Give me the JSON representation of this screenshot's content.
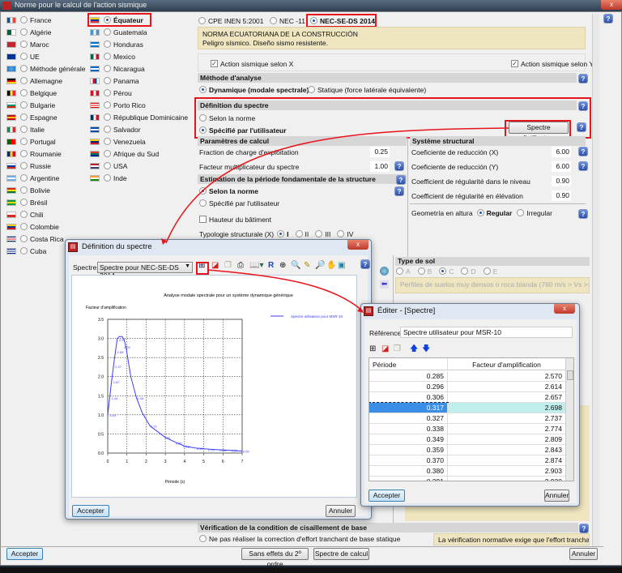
{
  "window": {
    "title": "Norme pour le calcul de l'action sismique",
    "close": "x"
  },
  "countries_col1": [
    {
      "label": "France",
      "flag": [
        "#0055a4",
        "#ffffff",
        "#ef4135"
      ],
      "dir": "v"
    },
    {
      "label": "Algérie",
      "flag": [
        "#006233",
        "#ffffff"
      ],
      "dir": "v"
    },
    {
      "label": "Maroc",
      "flag": [
        "#c1272d",
        "#c1272d"
      ],
      "dir": "v"
    },
    {
      "label": "UE",
      "flag": [
        "#003399",
        "#003399"
      ],
      "dir": "v"
    },
    {
      "label": "Méthode générale",
      "flag": [
        "#1b75c9",
        "#56a7e8"
      ],
      "dir": "globe"
    },
    {
      "label": "Allemagne",
      "flag": [
        "#000000",
        "#dd0000",
        "#ffce00"
      ],
      "dir": "h"
    },
    {
      "label": "Belgique",
      "flag": [
        "#000000",
        "#fae042",
        "#ed2939"
      ],
      "dir": "v"
    },
    {
      "label": "Bulgarie",
      "flag": [
        "#ffffff",
        "#00966e",
        "#d62612"
      ],
      "dir": "h"
    },
    {
      "label": "Espagne",
      "flag": [
        "#c60b1e",
        "#ffc400",
        "#c60b1e"
      ],
      "dir": "h"
    },
    {
      "label": "Italie",
      "flag": [
        "#009246",
        "#ffffff",
        "#ce2b37"
      ],
      "dir": "v"
    },
    {
      "label": "Portugal",
      "flag": [
        "#006600",
        "#ff0000"
      ],
      "dir": "v"
    },
    {
      "label": "Roumanie",
      "flag": [
        "#002b7f",
        "#fcd116",
        "#ce1126"
      ],
      "dir": "v"
    },
    {
      "label": "Russie",
      "flag": [
        "#ffffff",
        "#0039a6",
        "#d52b1e"
      ],
      "dir": "h"
    },
    {
      "label": "Argentine",
      "flag": [
        "#74acdf",
        "#ffffff",
        "#74acdf"
      ],
      "dir": "h"
    },
    {
      "label": "Bolivie",
      "flag": [
        "#d52b1e",
        "#f9e300",
        "#007934"
      ],
      "dir": "h"
    },
    {
      "label": "Brésil",
      "flag": [
        "#009c3b",
        "#ffdf00",
        "#009c3b"
      ],
      "dir": "h"
    },
    {
      "label": "Chili",
      "flag": [
        "#ffffff",
        "#d52b1e"
      ],
      "dir": "h"
    },
    {
      "label": "Colombie",
      "flag": [
        "#fcd116",
        "#003893",
        "#ce1126"
      ],
      "dir": "h"
    },
    {
      "label": "Costa Rica",
      "flag": [
        "#002b7f",
        "#ffffff",
        "#ce1126",
        "#ffffff",
        "#002b7f"
      ],
      "dir": "h"
    },
    {
      "label": "Cuba",
      "flag": [
        "#002a8f",
        "#ffffff",
        "#002a8f",
        "#ffffff",
        "#002a8f"
      ],
      "dir": "h"
    }
  ],
  "countries_col2": [
    {
      "label": "Équateur",
      "flag": [
        "#ffd100",
        "#0033a0",
        "#ef3340"
      ],
      "dir": "h",
      "selected": true
    },
    {
      "label": "Guatemala",
      "flag": [
        "#4997d0",
        "#ffffff",
        "#4997d0"
      ],
      "dir": "v"
    },
    {
      "label": "Honduras",
      "flag": [
        "#0073cf",
        "#ffffff",
        "#0073cf"
      ],
      "dir": "h"
    },
    {
      "label": "Mexico",
      "flag": [
        "#006847",
        "#ffffff",
        "#ce1126"
      ],
      "dir": "v"
    },
    {
      "label": "Nicaragua",
      "flag": [
        "#0067c6",
        "#ffffff",
        "#0067c6"
      ],
      "dir": "h"
    },
    {
      "label": "Panama",
      "flag": [
        "#ffffff",
        "#d21034",
        "#005293",
        "#ffffff"
      ],
      "dir": "v"
    },
    {
      "label": "Pérou",
      "flag": [
        "#d91023",
        "#ffffff",
        "#d91023"
      ],
      "dir": "v"
    },
    {
      "label": "Porto Rico",
      "flag": [
        "#ed0000",
        "#ffffff",
        "#ed0000",
        "#ffffff",
        "#ed0000"
      ],
      "dir": "h"
    },
    {
      "label": "République Dominicaine",
      "flag": [
        "#002d62",
        "#ffffff",
        "#ce1126"
      ],
      "dir": "v"
    },
    {
      "label": "Salvador",
      "flag": [
        "#0047ab",
        "#ffffff",
        "#0047ab"
      ],
      "dir": "h"
    },
    {
      "label": "Venezuela",
      "flag": [
        "#ffcc00",
        "#00247d",
        "#cf142b"
      ],
      "dir": "h"
    },
    {
      "label": "Afrique du Sud",
      "flag": [
        "#de3831",
        "#007a4d",
        "#002395"
      ],
      "dir": "h"
    },
    {
      "label": "USA",
      "flag": [
        "#b22234",
        "#ffffff",
        "#3c3b6e"
      ],
      "dir": "h"
    },
    {
      "label": "Inde",
      "flag": [
        "#ff9933",
        "#ffffff",
        "#138808"
      ],
      "dir": "h"
    }
  ],
  "norms": {
    "options": [
      "CPE INEN 5:2001",
      "NEC -11",
      "NEC-SE-DS 2014"
    ],
    "selected": "NEC-SE-DS 2014",
    "info_line1": "NORMA ECUATORIANA DE LA CONSTRUCCIÓN",
    "info_line2": "Peligro sísmico. Diseño sismo resistente."
  },
  "action": {
    "x": "Action sismique selon X",
    "y": "Action sismique selon Y",
    "x_checked": true,
    "y_checked": true
  },
  "methode": {
    "title": "Méthode d'analyse",
    "dynamique": "Dynamique (modale spectrale)",
    "statique": "Statique (force latérale équivalente)",
    "selected": "dynamique"
  },
  "spectre": {
    "title": "Définition du spectre",
    "selon": "Selon la norme",
    "specifie": "Spécifié par l'utilisateur",
    "selected": "specifie",
    "button": "Spectre d'utilisateur"
  },
  "parametres": {
    "title": "Paramètres de calcul",
    "fraction_label": "Fraction de charge d'exploitation",
    "fraction": "0.25",
    "facteur_label": "Facteur multiplicateur du spectre",
    "facteur": "1.00"
  },
  "estimation": {
    "title": "Estimation de la période fondamentale de la structure",
    "selon": "Selon la norme",
    "specifie": "Spécifié par l'utilisateur",
    "hauteur": "Hauteur du bâtiment",
    "typologie": "Typologie structurale (X)",
    "typ_options": [
      "I",
      "II",
      "III",
      "IV"
    ],
    "typ_selected": "I"
  },
  "systeme": {
    "title": "Système structural",
    "rows": [
      {
        "label": "Coeficiente de reducción (X)",
        "value": "6.00"
      },
      {
        "label": "Coeficiente de reducción (Y)",
        "value": "6.00"
      },
      {
        "label": "Coefficient de régularité dans le niveau",
        "value": "0.90"
      },
      {
        "label": "Coefficient de régularité en élévation",
        "value": "0.90"
      }
    ],
    "geometria": "Geometría en altura",
    "regular": "Regular",
    "irregular": "Irregular",
    "geo_selected": "Regular"
  },
  "sol": {
    "title": "Type de sol",
    "options": [
      "A",
      "B",
      "C",
      "D",
      "E"
    ],
    "selected": "C",
    "info": "Perfiles de suelos muy densos o roca blanda (760 m/s > Vs >= 360 m/s"
  },
  "verification": {
    "title": "Vérification de la condition de cisaillement de base",
    "option": "Ne pas réaliser la correction d'effort tranchant de base statique",
    "info": "La vérification normative exige que l'effort tranchant de"
  },
  "footer": {
    "accept": "Accepter",
    "sans_effets": "Sans effets du 2º ordre",
    "spectre_calcul": "Spectre de calcul",
    "cancel": "Annuler"
  },
  "dialog_spectre": {
    "title": "Définition du spectre",
    "spectre_label": "Spectre",
    "spectre_value": "Spectre pour NEC-SE-DS 2014",
    "accept": "Accepter",
    "cancel": "Annuler"
  },
  "chart_data": {
    "type": "line",
    "title": "Analyse modale spectrale pour un système dynamique générique",
    "ylabel": "Facteur d'amplification",
    "xlabel": "Période (s)",
    "xlim": [
      0,
      7
    ],
    "ylim": [
      0,
      3.5
    ],
    "grid": true,
    "legend": "top-right",
    "xticks": [
      "0",
      "1",
      "2",
      "3",
      "4",
      "5",
      "6",
      "7"
    ],
    "yticks": [
      "0.0",
      "0.5",
      "1.0",
      "1.5",
      "2.0",
      "2.5",
      "3.0",
      "3.5"
    ],
    "series": [
      {
        "name": "Spectre utilisateur pour MSR-10",
        "color": "#3b3bff",
        "points": [
          [
            0,
            1.0
          ],
          [
            0.1,
            1.44
          ],
          [
            0.2,
            1.87
          ],
          [
            0.3,
            2.27
          ],
          [
            0.4,
            2.65
          ],
          [
            0.5,
            3.0
          ],
          [
            0.6,
            3.05
          ],
          [
            0.75,
            3.05
          ],
          [
            0.85,
            2.97
          ],
          [
            0.95,
            2.78
          ],
          [
            1.2,
            2.0
          ],
          [
            1.5,
            1.44
          ],
          [
            1.8,
            1.05
          ],
          [
            2.2,
            0.71
          ],
          [
            3.0,
            0.41
          ],
          [
            3.5,
            0.29
          ],
          [
            4.0,
            0.18
          ],
          [
            4.6,
            0.13
          ],
          [
            5.3,
            0.1
          ],
          [
            6.0,
            0.08
          ],
          [
            6.5,
            0.07
          ],
          [
            7.0,
            0.05
          ]
        ],
        "labels": [
          [
            0.25,
            1.0,
            "1.00"
          ],
          [
            0.35,
            1.44,
            "1.44"
          ],
          [
            0.45,
            1.87,
            "1.87"
          ],
          [
            0.55,
            2.27,
            "2.27"
          ],
          [
            0.65,
            2.65,
            "2.65"
          ],
          [
            0.75,
            2.97,
            "2.97"
          ],
          [
            1.0,
            2.78,
            "2.78"
          ],
          [
            1.7,
            1.44,
            "1.44"
          ],
          [
            2.4,
            0.71,
            "0.71"
          ],
          [
            3.1,
            0.41,
            "0.41"
          ],
          [
            3.7,
            0.26,
            "0.26"
          ],
          [
            4.1,
            0.18,
            "0.18"
          ],
          [
            4.8,
            0.13,
            "0.13"
          ],
          [
            5.4,
            0.1,
            "0.10"
          ],
          [
            6.0,
            0.08,
            "0.08"
          ],
          [
            6.6,
            0.07,
            "0.07"
          ],
          [
            7.2,
            0.05,
            "0.05"
          ]
        ]
      }
    ]
  },
  "dialog_edit": {
    "title": "Éditer - [Spectre]",
    "ref_label": "Référence",
    "ref_value": "Spectre utilisateur pour MSR-10",
    "columns": [
      "Période",
      "Facteur d'amplification"
    ],
    "rows": [
      [
        "0.285",
        "2.570"
      ],
      [
        "0.296",
        "2.614"
      ],
      [
        "0.306",
        "2.657"
      ],
      [
        "0.317",
        "2.698"
      ],
      [
        "0.327",
        "2.737"
      ],
      [
        "0.338",
        "2.774"
      ],
      [
        "0.349",
        "2.809"
      ],
      [
        "0.359",
        "2.843"
      ],
      [
        "0.370",
        "2.874"
      ],
      [
        "0.380",
        "2.903"
      ],
      [
        "0.391",
        "2.930"
      ]
    ],
    "selected_row": 3,
    "accept": "Accepter",
    "cancel": "Annuler"
  }
}
